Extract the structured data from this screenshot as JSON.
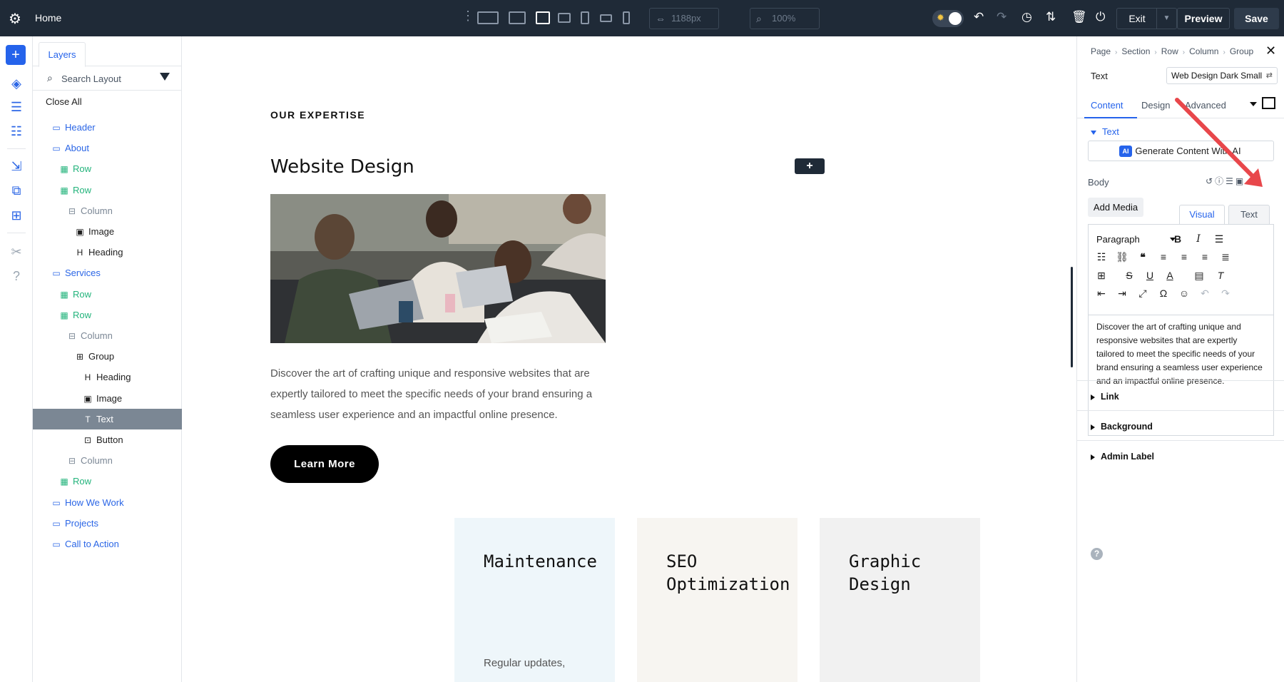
{
  "topbar": {
    "home_label": "Home",
    "width_value": "1188px",
    "zoom_value": "100%",
    "exit_label": "Exit",
    "preview_label": "Preview",
    "save_label": "Save"
  },
  "layers": {
    "tab_label": "Layers",
    "search_placeholder": "Search Layout",
    "close_all_label": "Close All",
    "items": [
      {
        "label": "Header",
        "kind": "section",
        "depth": 0
      },
      {
        "label": "About",
        "kind": "section",
        "depth": 0
      },
      {
        "label": "Row",
        "kind": "row",
        "depth": 1
      },
      {
        "label": "Row",
        "kind": "row",
        "depth": 1
      },
      {
        "label": "Column",
        "kind": "column",
        "depth": 2
      },
      {
        "label": "Image",
        "kind": "module",
        "icon": "image",
        "depth": 3
      },
      {
        "label": "Heading",
        "kind": "module",
        "icon": "heading",
        "depth": 3
      },
      {
        "label": "Services",
        "kind": "section",
        "depth": 0
      },
      {
        "label": "Row",
        "kind": "row",
        "depth": 1
      },
      {
        "label": "Row",
        "kind": "row",
        "depth": 1
      },
      {
        "label": "Column",
        "kind": "column",
        "depth": 2
      },
      {
        "label": "Group",
        "kind": "module",
        "icon": "group",
        "depth": 3
      },
      {
        "label": "Heading",
        "kind": "module",
        "icon": "heading",
        "depth": 4
      },
      {
        "label": "Image",
        "kind": "module",
        "icon": "image",
        "depth": 4
      },
      {
        "label": "Text",
        "kind": "module",
        "icon": "text",
        "depth": 4,
        "selected": true
      },
      {
        "label": "Button",
        "kind": "module",
        "icon": "button",
        "depth": 4
      },
      {
        "label": "Column",
        "kind": "column",
        "depth": 2
      },
      {
        "label": "Row",
        "kind": "row",
        "depth": 1
      },
      {
        "label": "How We Work",
        "kind": "section",
        "depth": 0
      },
      {
        "label": "Projects",
        "kind": "section",
        "depth": 0
      },
      {
        "label": "Call to Action",
        "kind": "section",
        "depth": 0
      }
    ]
  },
  "canvas": {
    "eyebrow": "OUR EXPERTISE",
    "heading": "Website Design",
    "paragraph": "Discover the art of crafting unique and responsive websites that are expertly tailored to meet the specific needs of your brand ensuring a seamless user experience and an impactful online presence.",
    "button_label": "Learn More",
    "cards": [
      {
        "title": "Maintenance",
        "desc": "Regular updates,",
        "bg": "#eef6fa"
      },
      {
        "title": "SEO Optimization",
        "desc": "",
        "bg": "#f7f5f1"
      },
      {
        "title": "Graphic Design",
        "desc": "",
        "bg": "#f1f1f1"
      }
    ]
  },
  "settings": {
    "breadcrumb": [
      "Page",
      "Section",
      "Row",
      "Column",
      "Group"
    ],
    "module_label": "Text",
    "preset_value": "Web Design Dark Small",
    "tabs": [
      "Content",
      "Design",
      "Advanced"
    ],
    "group_text_label": "Text",
    "generate_label": "Generate Content With AI",
    "ai_badge": "AI",
    "body_label": "Body",
    "add_media_label": "Add Media",
    "visual_tab": "Visual",
    "text_tab": "Text",
    "paragraph_select": "Paragraph",
    "body_text": "Discover the art of crafting unique and responsive websites that are expertly tailored to meet the specific needs of your brand ensuring a seamless user experience and an impactful online presence.",
    "collapsed_groups": [
      "Link",
      "Background",
      "Admin Label"
    ]
  },
  "colors": {
    "topbar_bg": "#1f2a37",
    "accent_blue": "#2563eb",
    "row_green": "#22b37b",
    "annotation_arrow": "#e8474b"
  }
}
